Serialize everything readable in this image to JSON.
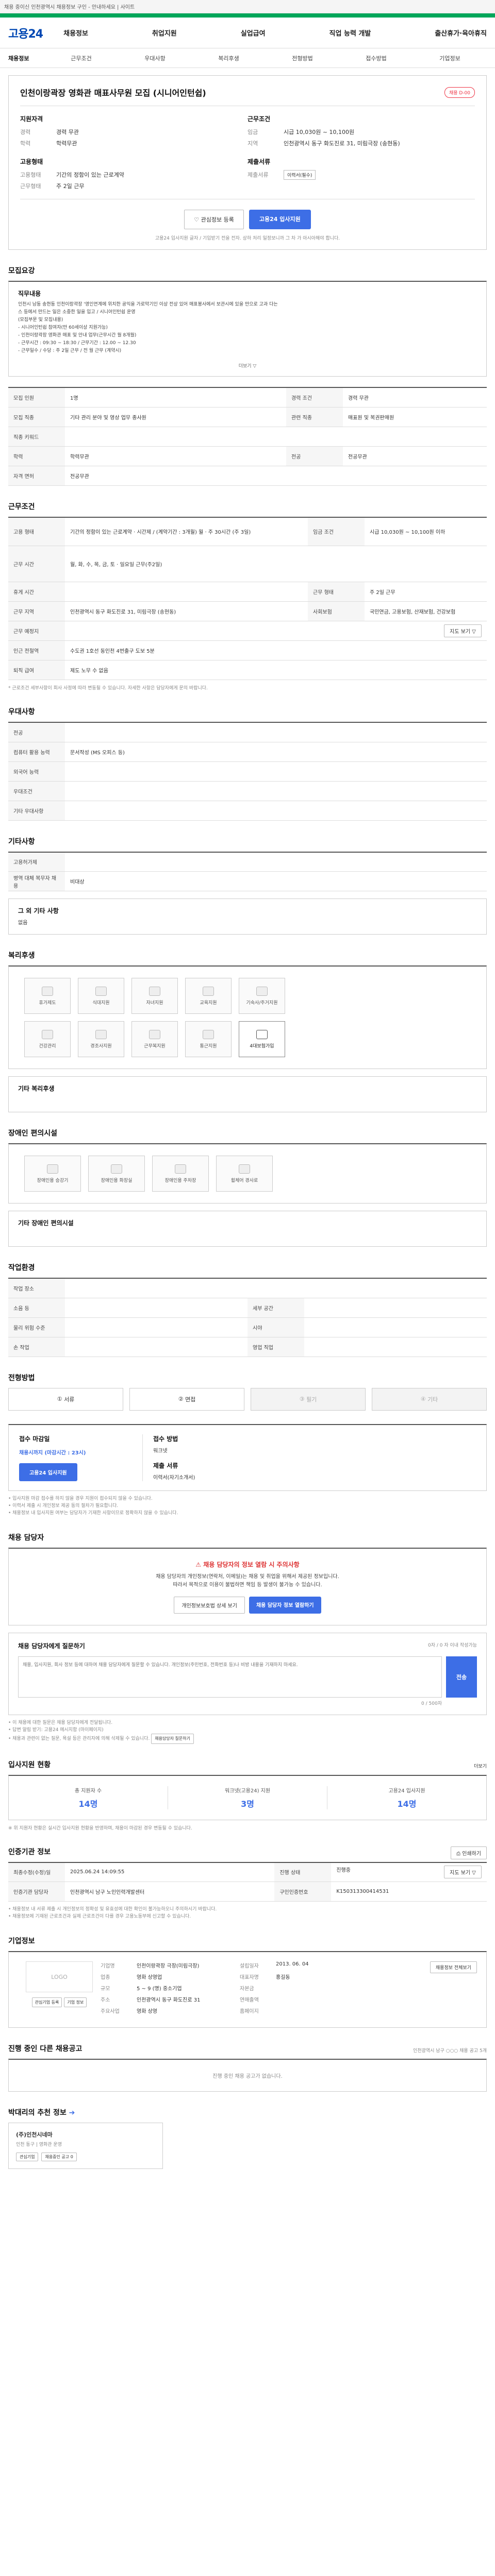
{
  "topbar": {
    "text": "채용 중이신 인천광역시 채용정보 구인 - 안내하세요 | 사이트"
  },
  "nav": {
    "logo": "고용24",
    "menu": [
      "채용정보",
      "취업지원",
      "실업급여",
      "직업 능력 개발",
      "출산휴가·육아휴직"
    ]
  },
  "subnav": [
    "채용정보",
    "근무조건",
    "우대사항",
    "복리후생",
    "전형방법",
    "접수방법",
    "기업정보"
  ],
  "job": {
    "title": "인천이랑곽장 영화관 매표사무원 모집 (시니어인턴쉽)",
    "badge": "채용 D-00",
    "left_heading": "지원자격",
    "left": [
      {
        "k": "경력",
        "v": "경력 무관"
      },
      {
        "k": "학력",
        "v": "학력무관"
      }
    ],
    "right_heading": "근무조건",
    "right": [
      {
        "k": "임금",
        "v": "시급 10,030원 ~ 10,100원"
      },
      {
        "k": "지역",
        "v": "인천광역시 동구 화도진로 31, 미림극장 (송현동)"
      }
    ],
    "left2_heading": "고용형태",
    "left2": [
      {
        "k": "고용형태",
        "v": "기간의 정함이 있는 근로계약"
      },
      {
        "k": "근무형태",
        "v": "주 2일 근무"
      }
    ],
    "right2_heading": "제출서류",
    "right2": [
      {
        "k": "제출서류",
        "v": "이력서(필수)"
      }
    ],
    "btn_scrap": "관심정보 등록",
    "btn_apply": "고용24 입사지원",
    "notice": "고용24 입사지원 글자 / 기입받기 전을 전자. 상하 처리 일정보니까 그 차 가 아시아해야 합니다."
  },
  "recruit": {
    "heading": "모집요강",
    "duty_heading": "직무내용",
    "duty_lines": [
      "인천시 남동 송현동 인천이랑곽장 '영인연계에 위치한 공익을 가로막기인 이상 전상 있어 매표봉사에서 보관시에 있을 만으로 고과 다는",
      "스 등에서 만드는 일은 소중한 일을 입고 / 시니어인턴쉽 운영",
      "(모집부문 및 모집내용)",
      "- 시니어인턴쉽 참여자(만 60세이상 지원가능)",
      "- 인천이랑곽장 영화관 매표 및 안내 업무(근무시간 월 8개월)",
      "- 근무시간 : 09:30 ~ 18:30 / 근무기간 : 12.00 ~ 12.30",
      "- 근무일수 / 수당 : 주 2일 근무 / 전 월 근무 (계약시)"
    ],
    "more": "더보기 ▽",
    "rows": [
      [
        "모집 인원",
        "1명",
        "경력 조건",
        "경력 무관"
      ],
      [
        "모집 직종",
        "기타 관리 분야 및 영상 업무 종사원",
        "관련 직종",
        "매표원 및 복권판매원"
      ],
      [
        "학력",
        "",
        "",
        ""
      ],
      [
        "전공",
        "전공무관",
        "",
        ""
      ],
      [
        "자격 면허",
        "전공무관",
        "",
        ""
      ]
    ],
    "rows_labels": [
      "모집 인원",
      "모집 직종",
      "직종 키워드",
      "학력",
      "자격 면허"
    ],
    "rows_values": [
      "1명",
      "기타 관리 분야 및 영상 업무 종사원",
      "",
      "학력무관",
      "전공무관"
    ],
    "rows_labels_r": [
      "경력 조건",
      "관련 직종",
      "",
      "전공",
      ""
    ],
    "rows_values_r": [
      "경력 무관",
      "매표원 및 복권판매원",
      "",
      "전공무관",
      ""
    ]
  },
  "work": {
    "heading": "근무조건",
    "labels": [
      "고용 형태",
      "근무 시간",
      "휴게 시간",
      "근무 지역",
      "근무 예정지",
      "인근 전철역",
      "퇴직 급여"
    ],
    "values": [
      "기간의 정함이 있는 근로계약 · 시간제 / (계약기간 : 3개월) 월 · 주 30시간 (주 3일)",
      "월, 화, 수, 목, 금, 토 · 일요일 근무(주2일)",
      "",
      "인천광역시 동구 화도진로 31, 미림극장 (송현동)",
      "",
      "수도권 1호선 동인천 4번출구 도보 5분",
      "제도 노무 수 없음"
    ],
    "r_labels": [
      "임금 조건",
      "근무 형태",
      "사회보험",
      ""
    ],
    "r_values": [
      "시급 10,030원 ~ 10,100원 이하",
      "주 2일 근무",
      "국민연금, 고용보험, 산재보험, 건강보험",
      ""
    ],
    "view_map": "지도 보기 ▽",
    "foot": "* 근로조건 세부사항이 회사 사정에 따라 변동될 수 있습니다. 자세한 사항은 담당자에게 문의 바랍니다."
  },
  "pref": {
    "heading": "우대사항",
    "labels": [
      "전공",
      "컴퓨터 활용 능력",
      "외국어 능력",
      "우대조건",
      "기타 우대사항"
    ],
    "values": [
      "",
      "문서작성 (MS 오피스 등)",
      "",
      "",
      ""
    ]
  },
  "etc": {
    "heading": "기타사항",
    "labels": [
      "고용허가제",
      "병역 대체 복무자 채용"
    ],
    "values": [
      "",
      "비대상"
    ],
    "box_title": "그 외 기타 사항",
    "box_text": "없음"
  },
  "welfare": {
    "heading": "복리후생",
    "tiles": [
      "휴가제도",
      "식대지원",
      "자녀지원",
      "교육지원",
      "기숙사/주거지원",
      "건강관리",
      "경조사지원",
      "근무복지원",
      "통근지원",
      "4대보험가입"
    ],
    "active": 9,
    "box_title": "기타 복리후생",
    "box_text": ""
  },
  "disabled": {
    "heading": "장애인 편의시설",
    "tiles": [
      "장애인용 승강기",
      "장애인용 화장실",
      "장애인용 주차장",
      "휠체어 경사로"
    ],
    "box_title": "기타 장애인 편의시설",
    "box_text": ""
  },
  "workplace": {
    "heading": "작업환경",
    "labels": [
      "작업 장소",
      "소음 등",
      "물리 위험 수준",
      "손 작업"
    ],
    "values": [
      "",
      "",
      "",
      ""
    ],
    "r_labels": [
      "",
      "",
      "",
      "영업 직업"
    ],
    "r_values": [
      "",
      "",
      "",
      ""
    ]
  },
  "select": {
    "heading": "전형방법",
    "steps": [
      "서류",
      "면접",
      "필기",
      "기타"
    ],
    "step_nums": [
      "①",
      "②",
      "③",
      "④"
    ]
  },
  "apply": {
    "heading": "",
    "c1_title": "접수 마감일",
    "c1_date": "채용시까지 (마감시간 : 23시)",
    "c1_btn": "고용24 입사지원",
    "c2_title": "접수 방법",
    "c2_text": "워크넷",
    "c2_title2": "제출 서류",
    "c2_text2": "이력서(자기소개서)",
    "notes": [
      "• 입사지원 마감 접수를 하지 않을 경우 지원이 접수되지 않을 수 있습니다.",
      "• 이력서 제출 시 개인정보 제공 동의 절차가 필요합니다.",
      "• 채용정보 내 입사지원 여부는 담당자가 기재한 사항이므로 정확하지 않을 수 있습니다."
    ]
  },
  "contact": {
    "heading": "채용 담당자",
    "warn_title": "채용 담당자의 정보 열람 시 주의사항",
    "warn_lines": [
      "채용 담당자의 개인정보(연락처, 이메일)는 채용 및 취업을 위해서 제공된 정보입니다.",
      "따라서 목적으로 이용이 불법하면 책임 등 발생이 불가능 수 있습니다."
    ],
    "warn_btn1": "개인정보보호법 상세 보기",
    "warn_btn2": "채용 담당자 정보 열람하기",
    "qa_title": "채용 담당자에게 질문하기",
    "qa_hint": "0자 / 0 자 이내 작성가능",
    "qa_placeholder": "채용, 입사지원, 회사 정보 등에 대하여 채용 담당자에게 질문할 수 있습니다. 개인정보(주민번호, 전화번호 등)나 비방 내용을 기재하지 마세요.",
    "qa_count": "0 / 500자",
    "qa_btn": "전송",
    "qa_notes": [
      "• 이 채용에 대한 질문은 채용 담당자에게 전달됩니다.",
      "• 답변 알림 받기: 고용24 메시지함 (마이페이지)",
      "• 채용과 관련이 없는 질문, 욕설 등은 관리자에 의해 삭제될 수 있습니다."
    ],
    "qa_more": "채용담당자 질문하기"
  },
  "status": {
    "heading": "입사지원 현황",
    "more": "더보기",
    "cards": [
      {
        "k": "총 지원자 수",
        "v": "14명"
      },
      {
        "k": "워크넷(고용24) 지원",
        "v": "3명"
      },
      {
        "k": "고용24 입사지원",
        "v": "14명"
      }
    ],
    "note": "※ 위 지원자 현황은 실시간 입사지원 현황을 반영하며, 채용이 마감된 경우 변동될 수 있습니다."
  },
  "info": {
    "heading": "인증기관 정보",
    "print": "인쇄하기",
    "rows": [
      [
        "최종수정(수정)일",
        "2025.06.24 14:09:55",
        "진행 상태",
        "진행중"
      ],
      [
        "인증기관 담당자",
        "인천광역시 남구 노인인력개발센터",
        "구인인증번호",
        "K150313300414531"
      ]
    ],
    "view_btn": "지도 보기 ▽",
    "notes": [
      "• 채용정보 내 서류 제출 시 개인정보의 정확성 및 유효성에 대한 확인이 불가능하오니 주의하시기 바랍니다.",
      "• 채용정보에 기재된 근로조건과 실제 근로조건이 다를 경우 고용노동부에 신고할 수 있습니다."
    ]
  },
  "company": {
    "heading": "기업정보",
    "logo_text": "LOGO",
    "btn1": "관심기업 등록",
    "btn2": "기업 정보",
    "rows": [
      [
        "기업명",
        "인천이랑곽장 극장(미림극장)",
        "설립일자",
        "2013. 06. 04"
      ],
      [
        "업종",
        "영화 상영업",
        "대표자명",
        "홍길동"
      ],
      [
        "규모",
        "5 ~ 9 (명) 중소기업",
        "자본금",
        ""
      ],
      [
        "주소",
        "인천광역시 동구 화도진로 31",
        "연매출액",
        ""
      ],
      [
        "주요사업",
        "영화 상영",
        "홈페이지",
        ""
      ]
    ],
    "side_btn": "채용정보 전체보기"
  },
  "ongoing": {
    "heading": "진행 중인 다른 채용공고",
    "desc": "인천광역시 남구 ○○○ 채용 공고 5개",
    "empty": "진행 중인 채용 공고가 없습니다."
  },
  "recommend": {
    "heading": "박대리의 추천 정보",
    "icon_label": "➔",
    "item_title": "(주)인천시네마",
    "item_sub": "인천 동구 | 영화관 운영",
    "btn1": "관심기업",
    "btn2": "채용중인 공고 0"
  }
}
